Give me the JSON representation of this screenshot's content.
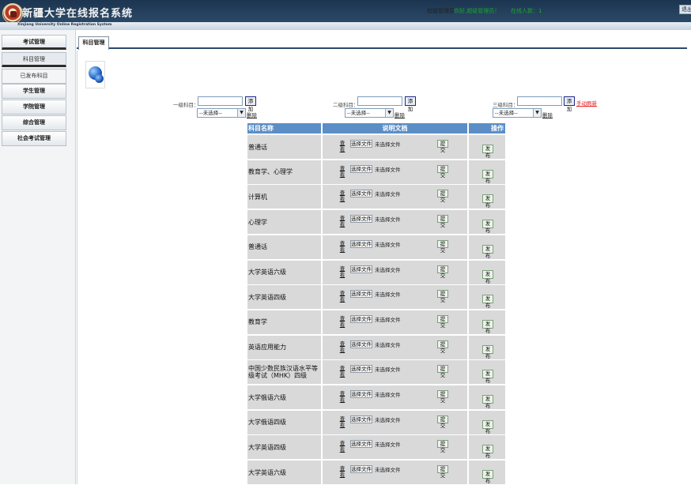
{
  "header": {
    "title": "新疆大学在线报名系统",
    "subtitle": "Xinjiang University Online Registration System",
    "user_role": "校级管理员",
    "user_name": "你好,超级管理员！",
    "online_count": "在线人数：1",
    "logout_label": "退出"
  },
  "sidebar": {
    "items": [
      {
        "label": "考试管理"
      },
      {
        "label": "科目管理"
      },
      {
        "label": "已发布科目"
      },
      {
        "label": "学生管理"
      },
      {
        "label": "学院管理"
      },
      {
        "label": "综合管理"
      },
      {
        "label": "社会考试管理"
      }
    ]
  },
  "tab": {
    "label": "科目管理"
  },
  "levels": [
    {
      "label": "一级科目：",
      "add_label": "添加",
      "select_value": "--未选择--",
      "delete_label": "删除"
    },
    {
      "label": "二级科目：",
      "add_label": "添加",
      "select_value": "--未选择--",
      "delete_label": "删除"
    },
    {
      "label": "三级科目：",
      "add_label": "添加",
      "select_value": "--未选择--",
      "delete_label": "删除"
    }
  ],
  "refresh_label": "手动刷新",
  "table": {
    "headers": [
      "科目名称",
      "说明文档",
      "操作"
    ],
    "view_label": "查 看",
    "file_label": "选择文件",
    "file_status": "未选择文件",
    "submit_label": "提交",
    "publish_label": "发布",
    "rows": [
      {
        "name": "普通话"
      },
      {
        "name": "教育学、心理学"
      },
      {
        "name": "计算机"
      },
      {
        "name": "心理学"
      },
      {
        "name": "普通话"
      },
      {
        "name": "大学英语六级"
      },
      {
        "name": "大学英语四级"
      },
      {
        "name": "教育学"
      },
      {
        "name": "英语应用能力"
      },
      {
        "name": "中国少数民族汉语水平等级考试（MHK）四级"
      },
      {
        "name": "大学俄语六级"
      },
      {
        "name": "大学俄语四级"
      },
      {
        "name": "大学英语四级"
      },
      {
        "name": "大学英语六级"
      }
    ]
  },
  "colors": {
    "header_bg": "#2a4866",
    "table_header": "#5b8ec6",
    "cell_bg": "#d9d9d9",
    "refresh_link": "#e41a1a"
  }
}
